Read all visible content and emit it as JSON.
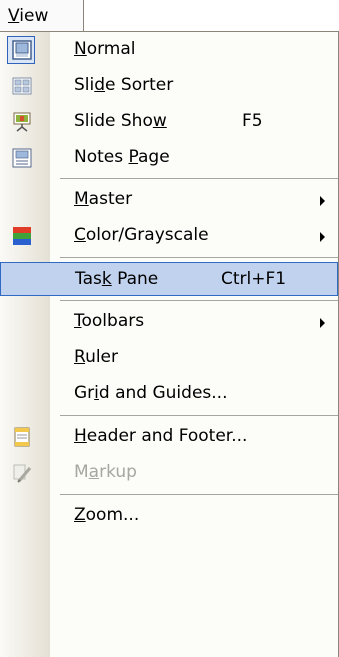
{
  "menubar": {
    "view_pre": "",
    "view_mn": "V",
    "view_post": "iew"
  },
  "items": [
    {
      "pre": "",
      "mn": "N",
      "post": "ormal",
      "icon": "normal-view-icon"
    },
    {
      "pre": "Sli",
      "mn": "d",
      "post": "e Sorter",
      "icon": "slide-sorter-icon"
    },
    {
      "pre": "Slide Sho",
      "mn": "w",
      "post": "",
      "shortcut": "F5",
      "icon": "slide-show-icon"
    },
    {
      "pre": "Notes ",
      "mn": "P",
      "post": "age",
      "icon": "notes-page-icon"
    },
    {
      "pre": "",
      "mn": "M",
      "post": "aster",
      "submenu": true
    },
    {
      "pre": "",
      "mn": "C",
      "post": "olor/Grayscale",
      "submenu": true,
      "icon": "color-grayscale-icon"
    },
    {
      "pre": "Tas",
      "mn": "k",
      "post": " Pane",
      "shortcut": "Ctrl+F1",
      "selected": true
    },
    {
      "pre": "",
      "mn": "T",
      "post": "oolbars",
      "submenu": true
    },
    {
      "pre": "",
      "mn": "R",
      "post": "uler"
    },
    {
      "pre": "Gr",
      "mn": "i",
      "post": "d and Guides..."
    },
    {
      "pre": "",
      "mn": "H",
      "post": "eader and Footer...",
      "icon": "header-footer-icon"
    },
    {
      "pre": "M",
      "mn": "a",
      "post": "rkup",
      "disabled": true,
      "icon": "markup-icon"
    },
    {
      "pre": "",
      "mn": "Z",
      "post": "oom..."
    }
  ]
}
